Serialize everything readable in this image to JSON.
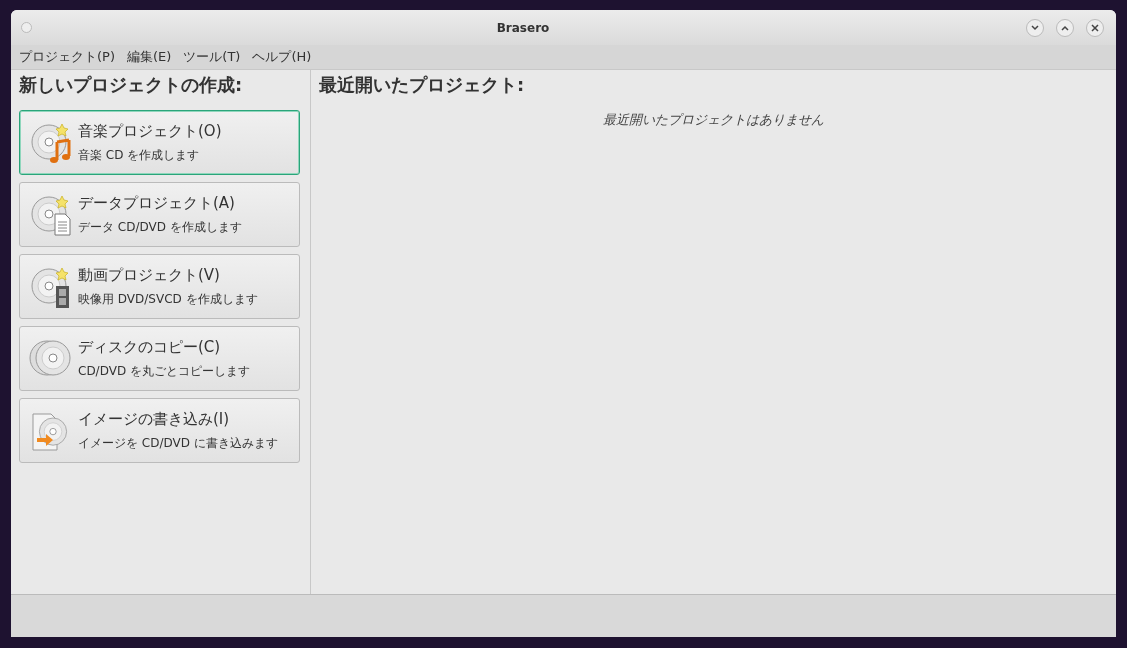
{
  "window": {
    "title": "Brasero"
  },
  "menu": [
    "プロジェクト(P)",
    "編集(E)",
    "ツール(T)",
    "ヘルプ(H)"
  ],
  "new_project": {
    "heading": "新しいプロジェクトの作成:",
    "items": [
      {
        "kind": "audio",
        "title": "音楽プロジェクト(O)",
        "description": "音楽 CD を作成します",
        "focused": true
      },
      {
        "kind": "data",
        "title": "データプロジェクト(A)",
        "description": "データ CD/DVD を作成します",
        "focused": false
      },
      {
        "kind": "video",
        "title": "動画プロジェクト(V)",
        "description": "映像用 DVD/SVCD を作成します",
        "focused": false
      },
      {
        "kind": "copy",
        "title": "ディスクのコピー(C)",
        "description": "CD/DVD を丸ごとコピーします",
        "focused": false
      },
      {
        "kind": "image",
        "title": "イメージの書き込み(I)",
        "description": "イメージを CD/DVD に書き込みます",
        "focused": false
      }
    ]
  },
  "recent": {
    "heading": "最近開いたプロジェクト:",
    "empty_message": "最近開いたプロジェクトはありません"
  }
}
